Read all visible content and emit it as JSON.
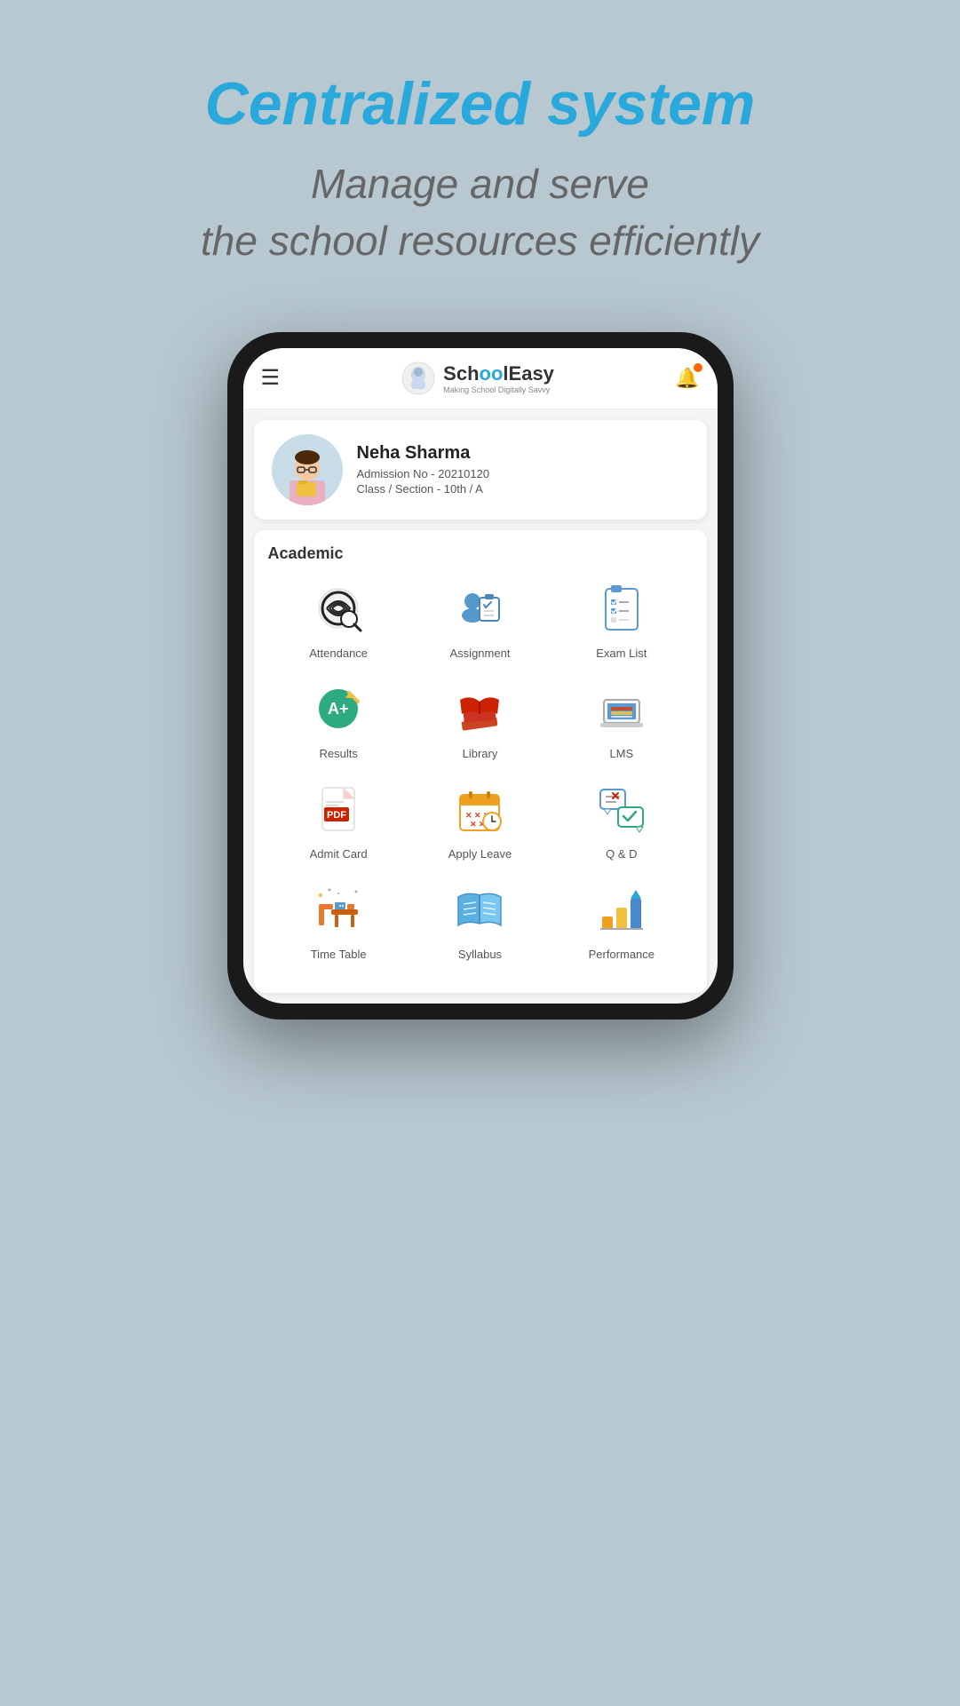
{
  "hero": {
    "title": "Centralized system",
    "subtitle_line1": "Manage and serve",
    "subtitle_line2": "the school resources efficiently"
  },
  "app_bar": {
    "logo_name_part1": "Sch",
    "logo_name_part2": "oo",
    "logo_name_part3": "lEasy",
    "tagline": "Making School Digitally Savvy"
  },
  "profile": {
    "name": "Neha Sharma",
    "admission": "Admission No - 20210120",
    "class_section": "Class / Section - 10th / A"
  },
  "academic": {
    "section_title": "Academic",
    "items": [
      {
        "id": "attendance",
        "label": "Attendance"
      },
      {
        "id": "assignment",
        "label": "Assignment"
      },
      {
        "id": "exam-list",
        "label": "Exam List"
      },
      {
        "id": "results",
        "label": "Results"
      },
      {
        "id": "library",
        "label": "Library"
      },
      {
        "id": "lms",
        "label": "LMS"
      },
      {
        "id": "admit-card",
        "label": "Admit Card"
      },
      {
        "id": "apply-leave",
        "label": "Apply Leave"
      },
      {
        "id": "qd",
        "label": "Q & D"
      },
      {
        "id": "timetable",
        "label": "Time Table"
      },
      {
        "id": "syllabus",
        "label": "Syllabus"
      },
      {
        "id": "performance",
        "label": "Performance"
      }
    ]
  },
  "colors": {
    "primary_blue": "#29a8db",
    "background": "#b8c8d0",
    "accent_orange": "#ff6600"
  }
}
